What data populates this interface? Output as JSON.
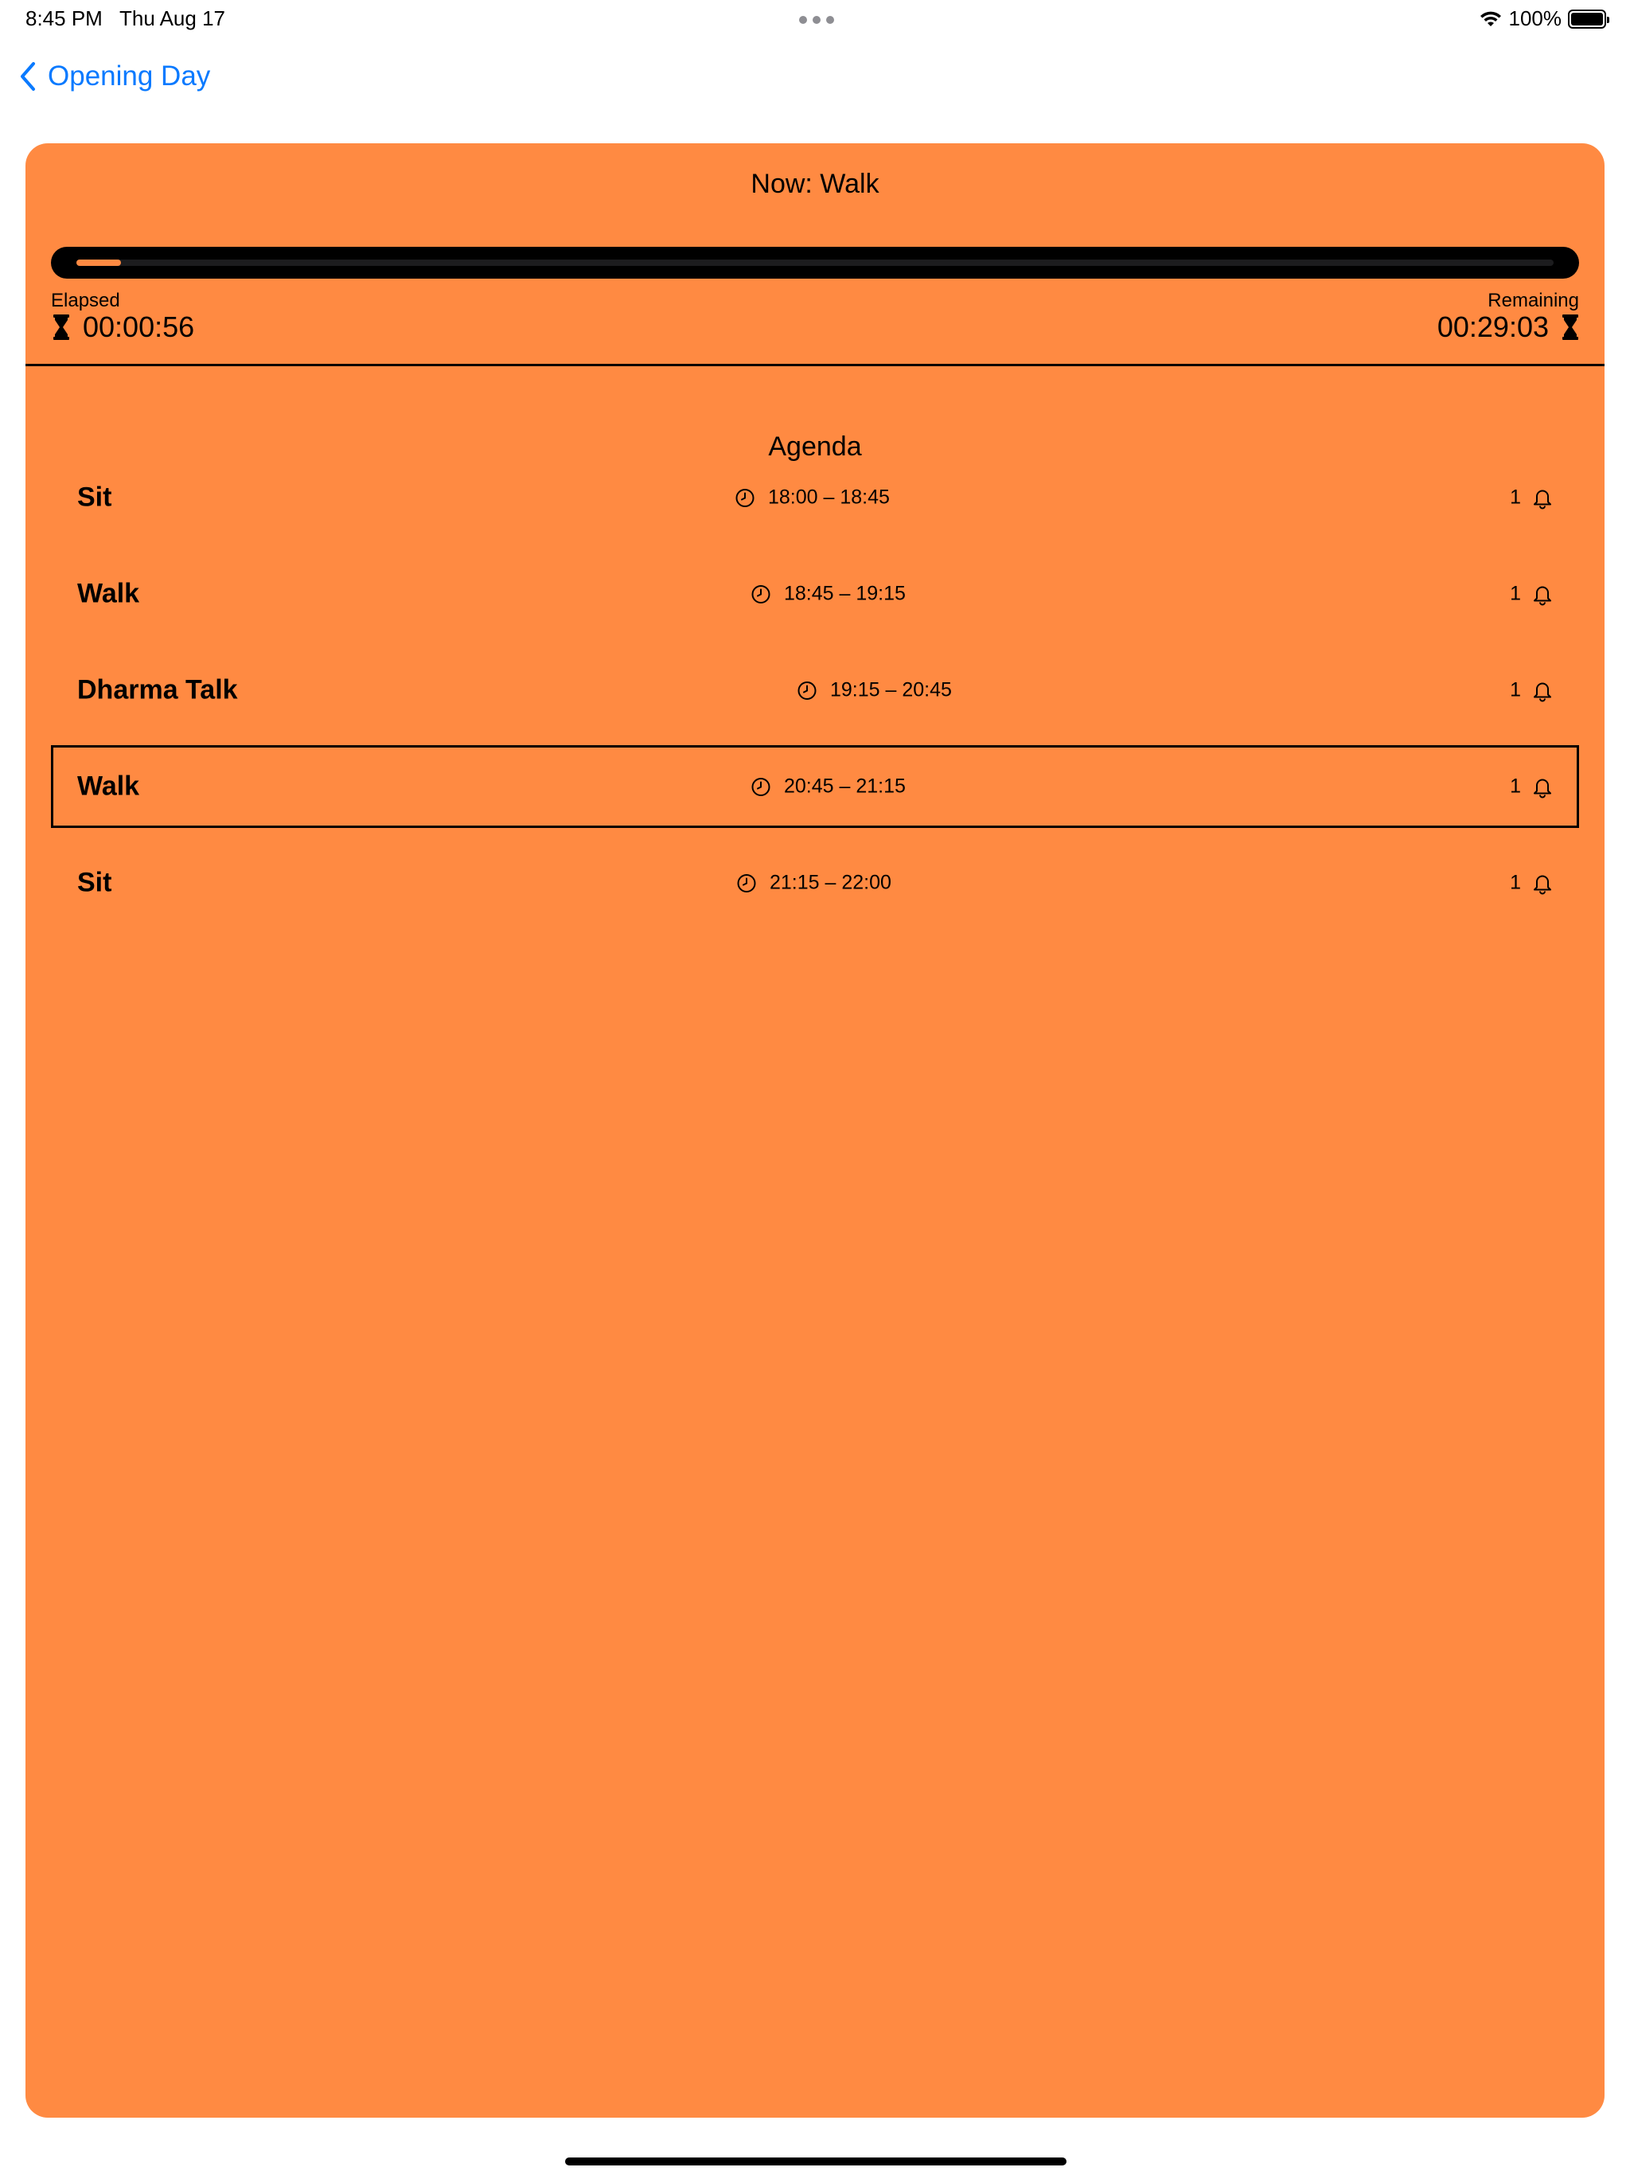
{
  "status_bar": {
    "time": "8:45 PM",
    "date": "Thu Aug 17",
    "battery": "100%"
  },
  "nav": {
    "back_label": "Opening Day"
  },
  "session": {
    "now_title": "Now: Walk",
    "progress_fraction": 0.03,
    "elapsed_label": "Elapsed",
    "elapsed_value": "00:00:56",
    "remaining_label": "Remaining",
    "remaining_value": "00:29:03"
  },
  "agenda": {
    "title": "Agenda",
    "items": [
      {
        "name": "Sit",
        "time": "18:00 – 18:45",
        "bells": "1",
        "current": false
      },
      {
        "name": "Walk",
        "time": "18:45 – 19:15",
        "bells": "1",
        "current": false
      },
      {
        "name": "Dharma Talk",
        "time": "19:15 – 20:45",
        "bells": "1",
        "current": false
      },
      {
        "name": "Walk",
        "time": "20:45 – 21:15",
        "bells": "1",
        "current": true
      },
      {
        "name": "Sit",
        "time": "21:15 – 22:00",
        "bells": "1",
        "current": false
      }
    ]
  },
  "colors": {
    "accent": "#ff8a42",
    "link": "#0a7aff"
  },
  "icons": {
    "back": "chevron-left-icon",
    "time": "clock-icon",
    "bell": "bell-icon",
    "timer": "hourglass-icon"
  }
}
